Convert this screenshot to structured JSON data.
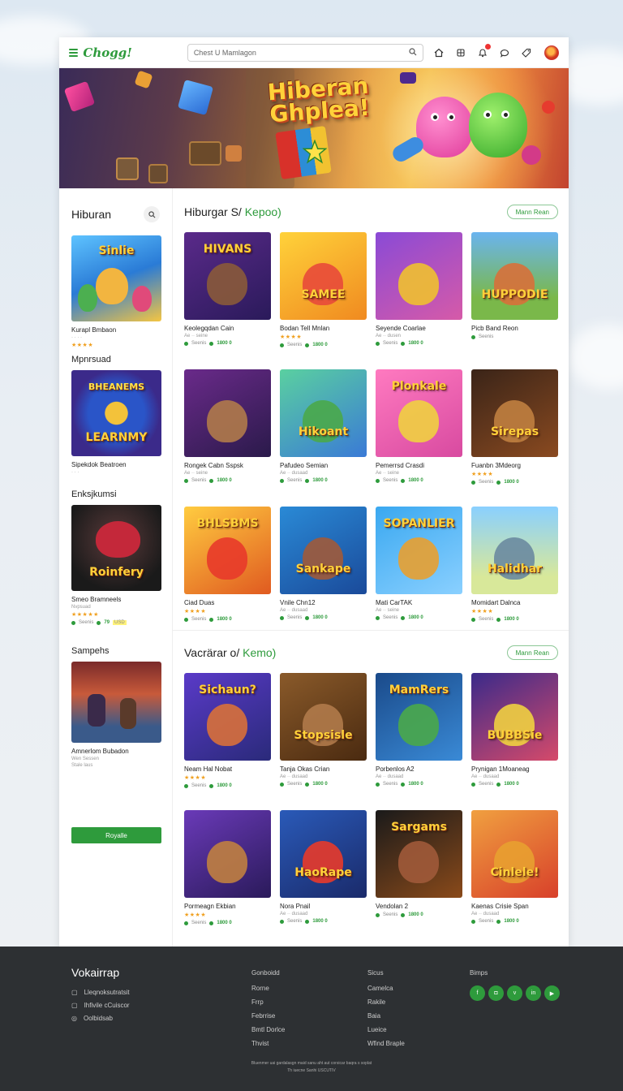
{
  "header": {
    "logo": "Chogg!",
    "search_placeholder": "Chest U Mamlagon",
    "icons": [
      "home-icon",
      "gamepad-icon",
      "notification-icon",
      "chat-icon",
      "tag-icon"
    ]
  },
  "banner": {
    "title": "Hiberan Ghplea!"
  },
  "sidebar": {
    "title": "Hiburan",
    "items": [
      {
        "section": "",
        "title": "Kurapl Bmbaon",
        "sub": "★★★★ ·",
        "stars": "★★★★",
        "meta": "",
        "art": "Sinlie"
      },
      {
        "section": "Mpnrsuad",
        "title": "Sipekdok Beatroen",
        "sub": "· · ·",
        "stars": "",
        "meta": "",
        "art": "LEARNMY"
      },
      {
        "section": "Enksjkumsi",
        "title": "Smeo Bramneels",
        "sub": "Nvpsuad",
        "stars": "★★★★★",
        "meta": "79",
        "art": "Roinfery"
      },
      {
        "section": "Sampehs",
        "title": "Amnerlom Bubadon",
        "sub": "Wen Sessen",
        "sub2": "Stale laus",
        "stars": "",
        "meta": "",
        "art": ""
      }
    ],
    "button": "Royalle"
  },
  "sections": [
    {
      "title": "Hiburgar S/",
      "accent": "Kepoo)",
      "more": "Mann Rean",
      "cards": [
        {
          "title": "Keolegqdan Cain",
          "sub": "Ae ·· seine",
          "stars": "",
          "meta": "1800 0",
          "art": "HIVANS"
        },
        {
          "title": "Bodan Tell Mnlan",
          "sub": "★★★★",
          "stars": "★★★★",
          "meta": "1800 0",
          "art": "SAMEE"
        },
        {
          "title": "Seyende Coarlae",
          "sub": "Ae ·· dusen",
          "stars": "",
          "meta": "1800 0",
          "art": ""
        },
        {
          "title": "Picb Band Reon",
          "sub": "",
          "stars": "",
          "meta": "",
          "art": "HUPPODIE"
        },
        {
          "title": "Rongek Cabn Sspsk",
          "sub": "Ae ·· seine",
          "stars": "",
          "meta": "1800 0",
          "art": ""
        },
        {
          "title": "Pafudeo Semian",
          "sub": "Ae ·· dusaad",
          "stars": "",
          "meta": "1800 0",
          "art": "Hikoant"
        },
        {
          "title": "Pemerrsd Crasdi",
          "sub": "Ae ·· seine",
          "stars": "",
          "meta": "1800 0",
          "art": "Plonkale"
        },
        {
          "title": "Fuanbn 3Mdeorg",
          "sub": "★★★★",
          "stars": "★★★★",
          "meta": "1800 0",
          "art": "Sirepas"
        },
        {
          "title": "Ciad Duas",
          "sub": "★★★★",
          "stars": "★★★★",
          "meta": "1800 0",
          "art": "BHLSBMS"
        },
        {
          "title": "Vnile Chn12",
          "sub": "Ae ·· dusaad",
          "stars": "",
          "meta": "1800 0",
          "art": "Sankape"
        },
        {
          "title": "Mati CarTAK",
          "sub": "Ae ·· seine",
          "stars": "",
          "meta": "1800 0",
          "art": "SOPANLIER"
        },
        {
          "title": "Momidart Dalnca",
          "sub": "★★★★",
          "stars": "★★★★",
          "meta": "1800 0",
          "art": "Halidhar"
        }
      ]
    },
    {
      "title": "Vacrärar o/",
      "accent": "Kemo)",
      "more": "Mann Rean",
      "cards": [
        {
          "title": "Neam Hal Nobat",
          "sub": "★★★★",
          "stars": "★★★★",
          "meta": "1800 0",
          "art": "Sichaun?"
        },
        {
          "title": "Tanja Okas Crian",
          "sub": "Ae ·· dusaad",
          "stars": "",
          "meta": "1800 0",
          "art": "Stopsisle"
        },
        {
          "title": "Porbenlos A2",
          "sub": "Ae ·· dusaad",
          "stars": "",
          "meta": "1800 0",
          "art": "MamRers"
        },
        {
          "title": "Prynigan 1Moaneag",
          "sub": "Ae ·· dusaad",
          "stars": "",
          "meta": "1800 0",
          "art": "BUBBSie"
        },
        {
          "title": "Pormeagn Ekbian",
          "sub": "★★★★",
          "stars": "★★★★",
          "meta": "1800 0",
          "art": ""
        },
        {
          "title": "Nora Pnail",
          "sub": "Ae ·· dusaad",
          "stars": "",
          "meta": "1800 0",
          "art": "HaoRape"
        },
        {
          "title": "Vendolan 2",
          "sub": "",
          "stars": "",
          "meta": "1800 0",
          "art": "Sargams"
        },
        {
          "title": "Kaenas Crisie Span",
          "sub": "Ae ·· dusaad",
          "stars": "",
          "meta": "1800 0",
          "art": "Cinlele!"
        }
      ]
    }
  ],
  "footer": {
    "title": "Vokairrap",
    "contacts": [
      "Lleqnoksutratsit",
      "Ihfivile cCuiscor",
      "Oolbidsab"
    ],
    "columns": [
      {
        "heading": "Gonboidd",
        "links": [
          "Rorne",
          "Frrp",
          "Febrrise",
          "Bmtl Dorlce",
          "Thvist"
        ]
      },
      {
        "heading": "Sicus",
        "links": [
          "Camelca",
          "Rakile",
          "Baia",
          "Lueice",
          "Wfind Braple"
        ]
      }
    ],
    "social_heading": "Bimps",
    "socials": [
      "f",
      "◘",
      "v",
      "in",
      "▶"
    ],
    "copyright": "Bluenmer uai gardalasgn maid sanu aht aut corsicar baqra s soplat",
    "copyright2": "Th iuecne Sanhi USCUTIV"
  },
  "colors": {
    "accent": "#2e9b3c",
    "footer": "#2d3033",
    "stars": "#f0a020"
  }
}
